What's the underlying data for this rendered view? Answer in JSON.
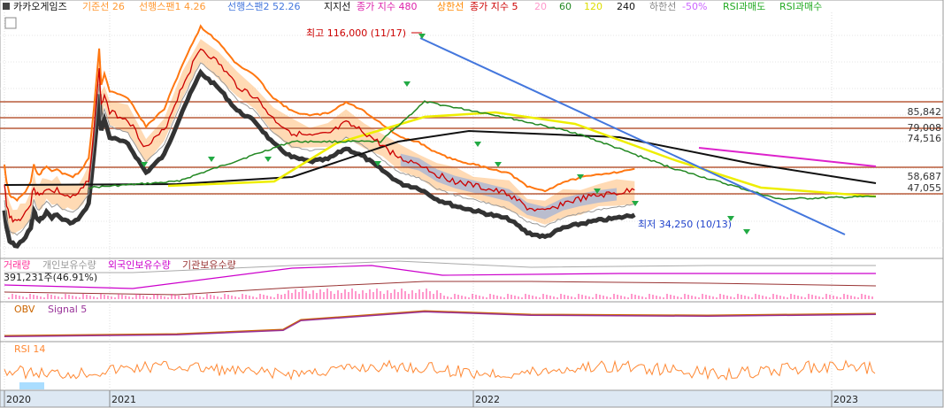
{
  "header": {
    "title": "카카오게임즈",
    "legend": [
      {
        "label": "기준선 26",
        "color": "#ff9933"
      },
      {
        "label": "선행스팬1 4.26",
        "color": "#ff9933"
      },
      {
        "label": "선행스팬2 52.26",
        "color": "#4477dd"
      },
      {
        "label": "지지선",
        "color": "#111111"
      },
      {
        "label": "종가 지수 480",
        "color": "#dd22aa"
      },
      {
        "label": "상한선",
        "color": "#ff8800"
      },
      {
        "label": "종가 지수 5",
        "color": "#cc0000"
      },
      {
        "label": "20",
        "color": "#ff99cc"
      },
      {
        "label": "60",
        "color": "#228822"
      },
      {
        "label": "120",
        "color": "#dddd00"
      },
      {
        "label": "240",
        "color": "#111111"
      },
      {
        "label": "하한선",
        "color": "#888888"
      },
      {
        "label": "-50%",
        "color": "#cc66ff"
      },
      {
        "label": "RSI과매도",
        "color": "#22aa22"
      },
      {
        "label": "RSI과매수",
        "color": "#22aa22"
      }
    ]
  },
  "annotations": {
    "high": "최고 116,000 (11/17)",
    "low": "최저 34,250 (10/13)"
  },
  "price_levels": [
    "85,842",
    "79,008",
    "74,516",
    "58,687",
    "47,055"
  ],
  "volume_pane": {
    "legend": [
      {
        "label": "거래량",
        "color": "#ff3399"
      },
      {
        "label": "개인보유수량",
        "color": "#999999"
      },
      {
        "label": "외국인보유수량",
        "color": "#cc00cc"
      },
      {
        "label": "기관보유수량",
        "color": "#993333"
      }
    ],
    "readout": "391,231주(46.91%)"
  },
  "obv_pane": {
    "legend": [
      {
        "label": "OBV",
        "color": "#cc6600"
      },
      {
        "label": "Signal 5",
        "color": "#993399"
      }
    ]
  },
  "rsi_pane": {
    "legend": [
      {
        "label": "RSI 14",
        "color": "#ff8833"
      }
    ]
  },
  "x_axis": {
    "labels": [
      "2020",
      "2021",
      "2022",
      "2023"
    ]
  },
  "colors": {
    "background": "#ffffff",
    "grid": "#d0d0d0",
    "level_line": "#b85c3a",
    "price": "#cc0000",
    "cloud_orange": "#ffa64d",
    "cloud_blue": "#6699ee",
    "trend_line": "#4477dd"
  },
  "chart_data": {
    "type": "line",
    "x_labels": [
      "2020",
      "2021",
      "2022",
      "2023"
    ],
    "price_high": 116000,
    "price_high_label": "11/17",
    "price_low": 34250,
    "price_low_label": "10/13",
    "horizontal_levels": [
      85842,
      79008,
      74516,
      58687,
      47055
    ],
    "ylim": [
      18000,
      128000
    ],
    "series": [
      {
        "name": "종가 지수 5",
        "values": [
          [
            0,
            50000
          ],
          [
            0.02,
            42000
          ],
          [
            0.05,
            36000
          ],
          [
            0.08,
            35000
          ],
          [
            0.12,
            34000
          ],
          [
            0.15,
            35500
          ],
          [
            0.2,
            38000
          ],
          [
            0.25,
            42000
          ],
          [
            0.28,
            50000
          ],
          [
            0.3,
            47000
          ],
          [
            0.33,
            45000
          ],
          [
            0.36,
            47000
          ],
          [
            0.4,
            49000
          ],
          [
            0.45,
            47000
          ],
          [
            0.5,
            48000
          ],
          [
            0.55,
            46000
          ],
          [
            0.6,
            45000
          ],
          [
            0.65,
            44500
          ],
          [
            0.7,
            46000
          ],
          [
            0.75,
            49000
          ],
          [
            0.8,
            53000
          ],
          [
            0.85,
            75000
          ],
          [
            0.9,
            102000
          ],
          [
            0.92,
            86000
          ],
          [
            0.95,
            91000
          ],
          [
            1.0,
            83000
          ],
          [
            1.05,
            80000
          ],
          [
            1.1,
            67000
          ],
          [
            1.15,
            75000
          ],
          [
            1.2,
            95000
          ],
          [
            1.25,
            112000
          ],
          [
            1.3,
            105000
          ],
          [
            1.35,
            95000
          ],
          [
            1.4,
            90000
          ],
          [
            1.45,
            80000
          ],
          [
            1.5,
            74000
          ],
          [
            1.55,
            72000
          ],
          [
            1.6,
            73000
          ],
          [
            1.65,
            78000
          ],
          [
            1.7,
            74000
          ],
          [
            1.75,
            68000
          ],
          [
            1.8,
            62000
          ],
          [
            1.85,
            60000
          ],
          [
            1.9,
            55000
          ],
          [
            1.95,
            52000
          ],
          [
            2.0,
            50000
          ],
          [
            2.05,
            48000
          ],
          [
            2.1,
            46000
          ],
          [
            2.15,
            40000
          ],
          [
            2.2,
            38000
          ],
          [
            2.25,
            42000
          ],
          [
            2.3,
            44000
          ],
          [
            2.35,
            45500
          ],
          [
            2.4,
            46500
          ],
          [
            2.45,
            48000
          ]
        ]
      }
    ]
  }
}
